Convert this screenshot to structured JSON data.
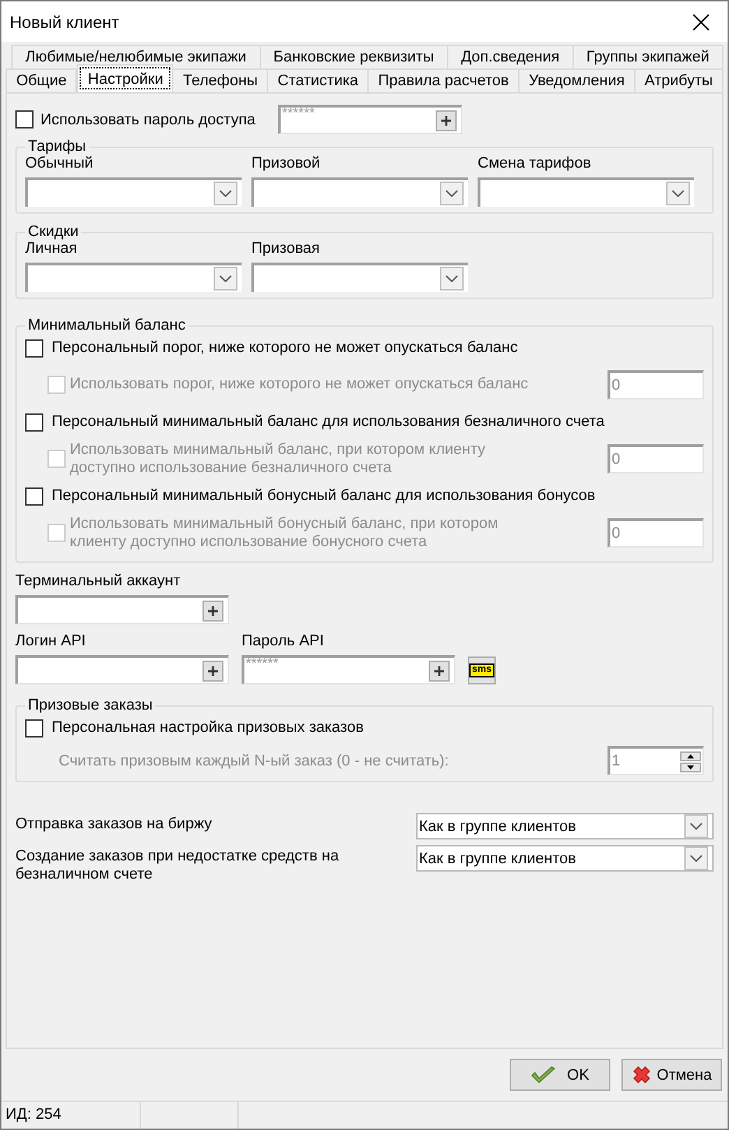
{
  "window": {
    "title": "Новый клиент"
  },
  "tab_rows": [
    [
      {
        "label": "Любимые/нелюбимые экипажи",
        "selected": false
      },
      {
        "label": "Банковские реквизиты",
        "selected": false
      },
      {
        "label": "Доп.сведения",
        "selected": false
      },
      {
        "label": "Группы экипажей",
        "selected": false
      }
    ],
    [
      {
        "label": "Общие",
        "selected": false
      },
      {
        "label": "Настройки",
        "selected": true
      },
      {
        "label": "Телефоны",
        "selected": false
      },
      {
        "label": "Статистика",
        "selected": false
      },
      {
        "label": "Правила расчетов",
        "selected": false
      },
      {
        "label": "Уведомления",
        "selected": false
      },
      {
        "label": "Атрибуты",
        "selected": false
      }
    ]
  ],
  "access_password": {
    "label": "Использовать пароль доступа",
    "checked": false,
    "value": "******"
  },
  "tariffs": {
    "title": "Тарифы",
    "fields": [
      {
        "label": "Обычный"
      },
      {
        "label": "Призовой"
      },
      {
        "label": "Смена тарифов"
      }
    ]
  },
  "discounts": {
    "title": "Скидки",
    "fields": [
      {
        "label": "Личная"
      },
      {
        "label": "Призовая"
      }
    ]
  },
  "min_balance": {
    "title": "Минимальный баланс",
    "items": [
      {
        "label": "Персональный порог, ниже которого не может опускаться баланс",
        "checked": false,
        "sub": {
          "label": "Использовать порог, ниже которого не может опускаться баланс",
          "checked": false,
          "disabled": true,
          "value": "0"
        }
      },
      {
        "label": "Персональный минимальный баланс для использования безналичного счета",
        "checked": false,
        "sub": {
          "label": "Использовать минимальный баланс, при котором клиенту доступно использование безналичного счета",
          "checked": false,
          "disabled": true,
          "value": "0"
        }
      },
      {
        "label": "Персональный минимальный бонусный баланс для использования бонусов",
        "checked": false,
        "sub": {
          "label": "Использовать минимальный бонусный баланс, при котором клиенту доступно использование бонусного счета",
          "checked": false,
          "disabled": true,
          "value": "0"
        }
      }
    ]
  },
  "terminal_account": {
    "label": "Терминальный аккаунт"
  },
  "api_login": {
    "label": "Логин API"
  },
  "api_password": {
    "label": "Пароль API",
    "value": "******"
  },
  "sms_button": {
    "label": "sms"
  },
  "prize_orders": {
    "title": "Призовые заказы",
    "personal": {
      "label": "Персональная настройка призовых заказов",
      "checked": false
    },
    "nth": {
      "label": "Считать призовым каждый N-ый заказ (0 - не считать):",
      "disabled": true,
      "value": "1"
    }
  },
  "settings": [
    {
      "label": "Отправка заказов на биржу",
      "value": "Как в группе клиентов"
    },
    {
      "label": "Создание заказов при недостатке средств на безналичном счете",
      "value": "Как в группе клиентов"
    }
  ],
  "buttons": [
    {
      "label": "OK",
      "kind": "ok"
    },
    {
      "label": "Отмена",
      "kind": "cancel"
    }
  ],
  "status_bar": [
    "ИД: 254"
  ]
}
